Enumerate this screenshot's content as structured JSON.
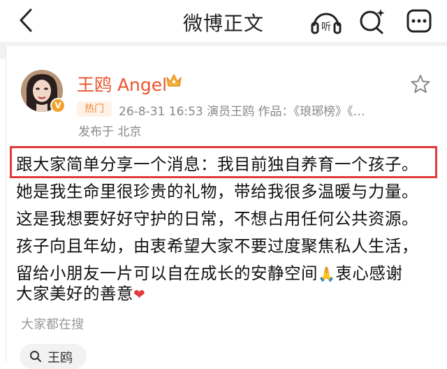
{
  "header": {
    "title": "微博正文",
    "back_icon": "chevron-left-icon",
    "listen_label": "听",
    "search_icon": "search-sparkle-icon",
    "more_icon": "more-dots-icon"
  },
  "post": {
    "author": "王鸥 Angel",
    "verified_badge": "V",
    "hot_tag": "热门",
    "meta": "26-8-31 16:53  演员王鸥  作品：《琅琊榜》《…",
    "location": "发布于 北京",
    "lines": [
      "跟大家简单分享一个消息：我目前独自养育一个孩子。",
      "她是我生命里很珍贵的礼物，带给我很多温暖与力量。",
      "这是我想要好好守护的日常，不想占用任何公共资源。",
      "孩子向且年幼，由衷希望大家不要过度聚焦私人生活，",
      "留给小朋友一片可以自在成长的安静空间",
      "衷心感谢",
      "大家美好的善意"
    ],
    "pray_emoji": "🙏",
    "heart_emoji": "❤"
  },
  "related": {
    "hint": "大家都在搜",
    "chip_label": "王鸥"
  },
  "colors": {
    "username": "#e8552e",
    "highlight_border": "#e23a3a",
    "hot_tag_bg": "#fff1e6",
    "hot_tag_text": "#f08a3e"
  }
}
